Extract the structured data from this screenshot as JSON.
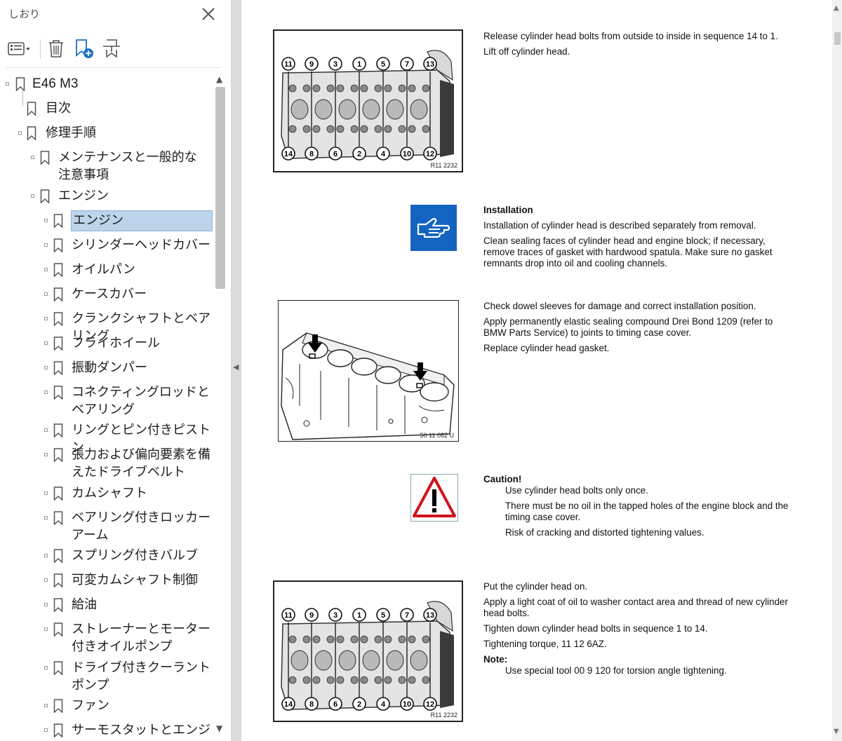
{
  "sidebar": {
    "title": "しおり",
    "close_icon": "close-icon",
    "toolbar": {
      "options_icon": "list-options-icon",
      "delete_icon": "trash-icon",
      "new_bookmark_icon": "add-bookmark-icon",
      "bookmark_from_selection_icon": "bookmark-search-icon"
    },
    "items": [
      {
        "label": "E46 M3",
        "level": 0
      },
      {
        "label": "目次",
        "level": 1
      },
      {
        "label": "修理手順",
        "level": 1
      },
      {
        "label": "メンテナンスと一般的な注意事項",
        "level": 2
      },
      {
        "label": "エンジン",
        "level": 2
      },
      {
        "label": "エンジン",
        "level": 3,
        "selected": true
      },
      {
        "label": "シリンダーヘッドカバー",
        "level": 3
      },
      {
        "label": "オイルパン",
        "level": 3
      },
      {
        "label": "ケースカバー",
        "level": 3
      },
      {
        "label": "クランクシャフトとベアリング",
        "level": 3
      },
      {
        "label": "フライホイール",
        "level": 3
      },
      {
        "label": "振動ダンパー",
        "level": 3
      },
      {
        "label": "コネクティングロッドとベアリング",
        "level": 3
      },
      {
        "label": "リングとピン付きピストン",
        "level": 3
      },
      {
        "label": "張力および偏向要素を備えたドライブベルト",
        "level": 3
      },
      {
        "label": "カムシャフト",
        "level": 3
      },
      {
        "label": "ベアリング付きロッカーアーム",
        "level": 3
      },
      {
        "label": "スプリング付きバルブ",
        "level": 3
      },
      {
        "label": "可変カムシャフト制御",
        "level": 3
      },
      {
        "label": "給油",
        "level": 3
      },
      {
        "label": "ストレーナーとモーター付きオイルポンプ",
        "level": 3
      },
      {
        "label": "ドライブ付きクーラントポンプ",
        "level": 3
      },
      {
        "label": "ファン",
        "level": 3
      },
      {
        "label": "サーモスタットとエンジン耐",
        "level": 3
      }
    ]
  },
  "document": {
    "section1": {
      "lines": [
        "Release cylinder head bolts from outside to inside in sequence 14 to 1.",
        "Lift off cylinder head."
      ],
      "figure_code": "R11 2232",
      "top_numbers": [
        "11",
        "9",
        "3",
        "1",
        "5",
        "7",
        "13"
      ],
      "bottom_numbers": [
        "14",
        "8",
        "6",
        "2",
        "4",
        "10",
        "12"
      ]
    },
    "section2": {
      "icon": "pointing-hand-icon",
      "heading": "Installation",
      "lines": [
        "Installation of cylinder head is described separately from removal.",
        "Clean sealing faces of cylinder head and engine block; if necessary, remove traces of gasket with hardwood spatula. Make sure no gasket remnants drop into oil and cooling channels."
      ]
    },
    "section3": {
      "figure_code": "50 11 082 U",
      "lines": [
        "Check dowel sleeves for damage and correct installation position.",
        "Apply permanently elastic sealing compound Drei Bond 1209 (refer to BMW Parts Service) to joints to timing case cover.",
        "Replace cylinder head gasket."
      ]
    },
    "section4": {
      "icon": "warning-triangle-icon",
      "heading": "Caution!",
      "lines": [
        "Use cylinder head bolts only once.",
        "There must be no oil in the tapped holes of the engine block and the timing case cover.",
        "Risk of cracking and distorted tightening values."
      ]
    },
    "section5": {
      "figure_code": "R11 2232",
      "lines": [
        "Put the cylinder head on.",
        "Apply a light coat of oil to washer contact area and thread of new cylinder head bolts.",
        "Tighten down cylinder head bolts in sequence 1 to 14.",
        "Tightening torque, 11 12 6AZ."
      ],
      "note_heading": "Note:",
      "note_line": "Use special tool 00 9 120 for torsion angle tightening.",
      "top_numbers": [
        "11",
        "9",
        "3",
        "1",
        "5",
        "7",
        "13"
      ],
      "bottom_numbers": [
        "14",
        "8",
        "6",
        "2",
        "4",
        "10",
        "12"
      ]
    }
  }
}
